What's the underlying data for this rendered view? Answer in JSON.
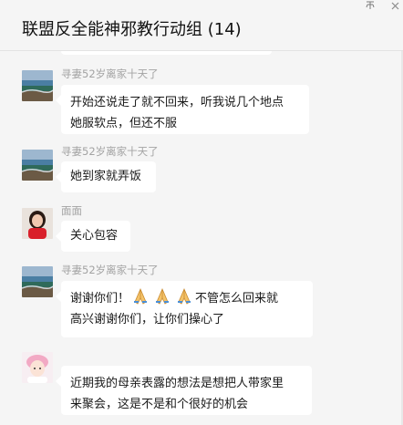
{
  "window": {
    "title": "联盟反全能神邪教行动组 (14)",
    "pin_glyph": "卒",
    "close_icon": "close-icon"
  },
  "messages": [
    {
      "sender": "寻妻52岁离家十天了",
      "lines": [
        "开始还说走了就不回来，听我说几个地点",
        "她服软点，但还不服"
      ],
      "avatar": "landscape-avatar"
    },
    {
      "sender": "寻妻52岁离家十天了",
      "lines": [
        "她到家就弄饭"
      ],
      "avatar": "landscape-avatar"
    },
    {
      "sender": "面面",
      "lines": [
        "关心包容"
      ],
      "avatar": "woman-red-avatar"
    },
    {
      "sender": "寻妻52岁离家十天了",
      "line1_before": "谢谢你们！",
      "line1_after": "不管怎么回来就",
      "line2": "高兴谢谢你们，让你们操心了",
      "emoji": "folded-hands",
      "emoji_count": 3,
      "avatar": "landscape-avatar"
    },
    {
      "lines": [
        "近期我的母亲表露的想法是想把人带家里",
        "来聚会，这是不是和个很好的机会"
      ],
      "avatar": "pink-hair-avatar"
    }
  ],
  "colors": {
    "background": "#f5f5f5",
    "bubble": "#ffffff",
    "sender": "#a3a3a3",
    "text": "#1a1a1a"
  }
}
